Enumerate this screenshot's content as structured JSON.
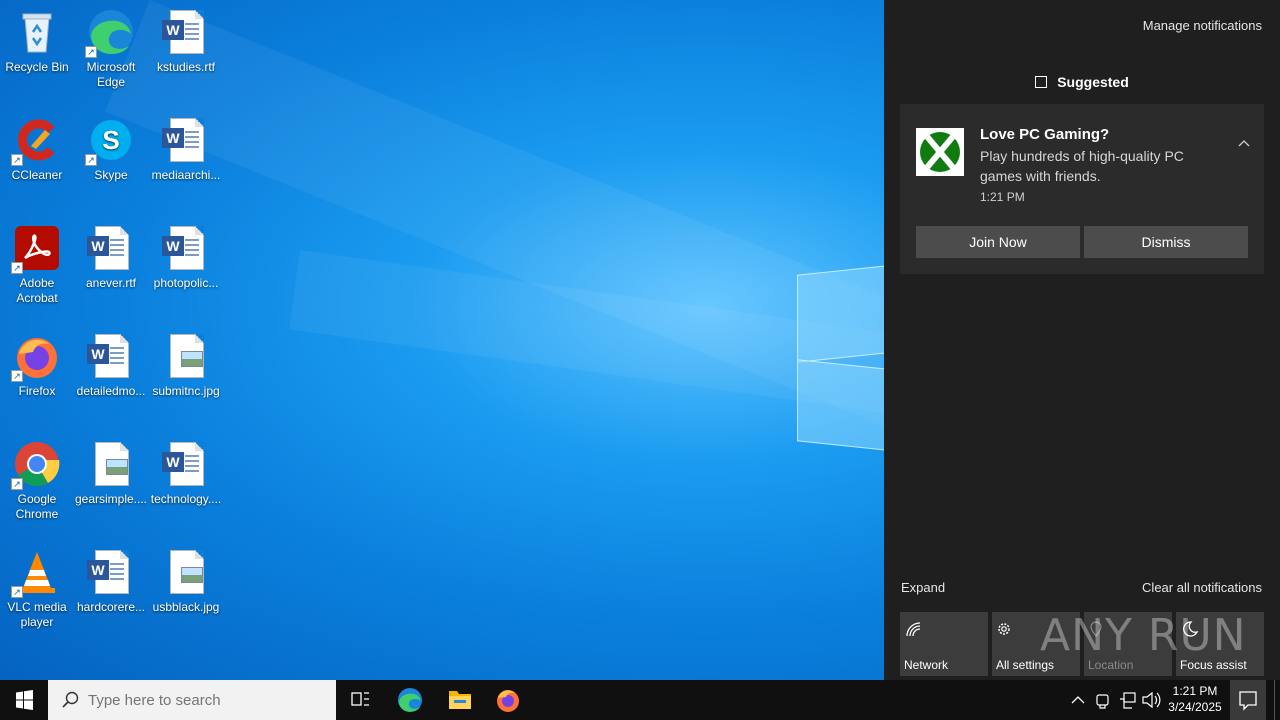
{
  "desktop": {
    "icons": [
      {
        "label": "Recycle Bin",
        "kind": "recycle-bin"
      },
      {
        "label": "Microsoft Edge",
        "kind": "edge"
      },
      {
        "label": "kstudies.rtf",
        "kind": "word"
      },
      {
        "label": "CCleaner",
        "kind": "ccleaner"
      },
      {
        "label": "Skype",
        "kind": "skype"
      },
      {
        "label": "mediaarchi...",
        "kind": "word"
      },
      {
        "label": "Adobe Acrobat",
        "kind": "acrobat"
      },
      {
        "label": "anever.rtf",
        "kind": "word"
      },
      {
        "label": "photopolic...",
        "kind": "word"
      },
      {
        "label": "Firefox",
        "kind": "firefox"
      },
      {
        "label": "detailedmo...",
        "kind": "word"
      },
      {
        "label": "submitnc.jpg",
        "kind": "image"
      },
      {
        "label": "Google Chrome",
        "kind": "chrome"
      },
      {
        "label": "gearsimple....",
        "kind": "image"
      },
      {
        "label": "technology....",
        "kind": "word"
      },
      {
        "label": "VLC media player",
        "kind": "vlc"
      },
      {
        "label": "hardcorere...",
        "kind": "word"
      },
      {
        "label": "usbblack.jpg",
        "kind": "image"
      }
    ]
  },
  "action_center": {
    "manage_notifications": "Manage notifications",
    "group_title": "Suggested",
    "notification": {
      "title": "Love PC Gaming?",
      "body": "Play hundreds of high-quality PC games with friends.",
      "time": "1:21 PM",
      "primary_button": "Join Now",
      "secondary_button": "Dismiss"
    },
    "expand": "Expand",
    "clear_all": "Clear all notifications",
    "quick_actions": [
      {
        "label": "Network",
        "icon": "network-icon",
        "enabled": true
      },
      {
        "label": "All settings",
        "icon": "gear-icon",
        "enabled": true
      },
      {
        "label": "Location",
        "icon": "location-icon",
        "enabled": false
      },
      {
        "label": "Focus assist",
        "icon": "moon-icon",
        "enabled": true
      }
    ],
    "watermark": "ANY RUN"
  },
  "taskbar": {
    "search_placeholder": "Type here to search",
    "pinned": [
      "task-view",
      "edge",
      "file-explorer",
      "firefox"
    ],
    "clock_time": "1:21 PM",
    "clock_date": "3/24/2025"
  }
}
